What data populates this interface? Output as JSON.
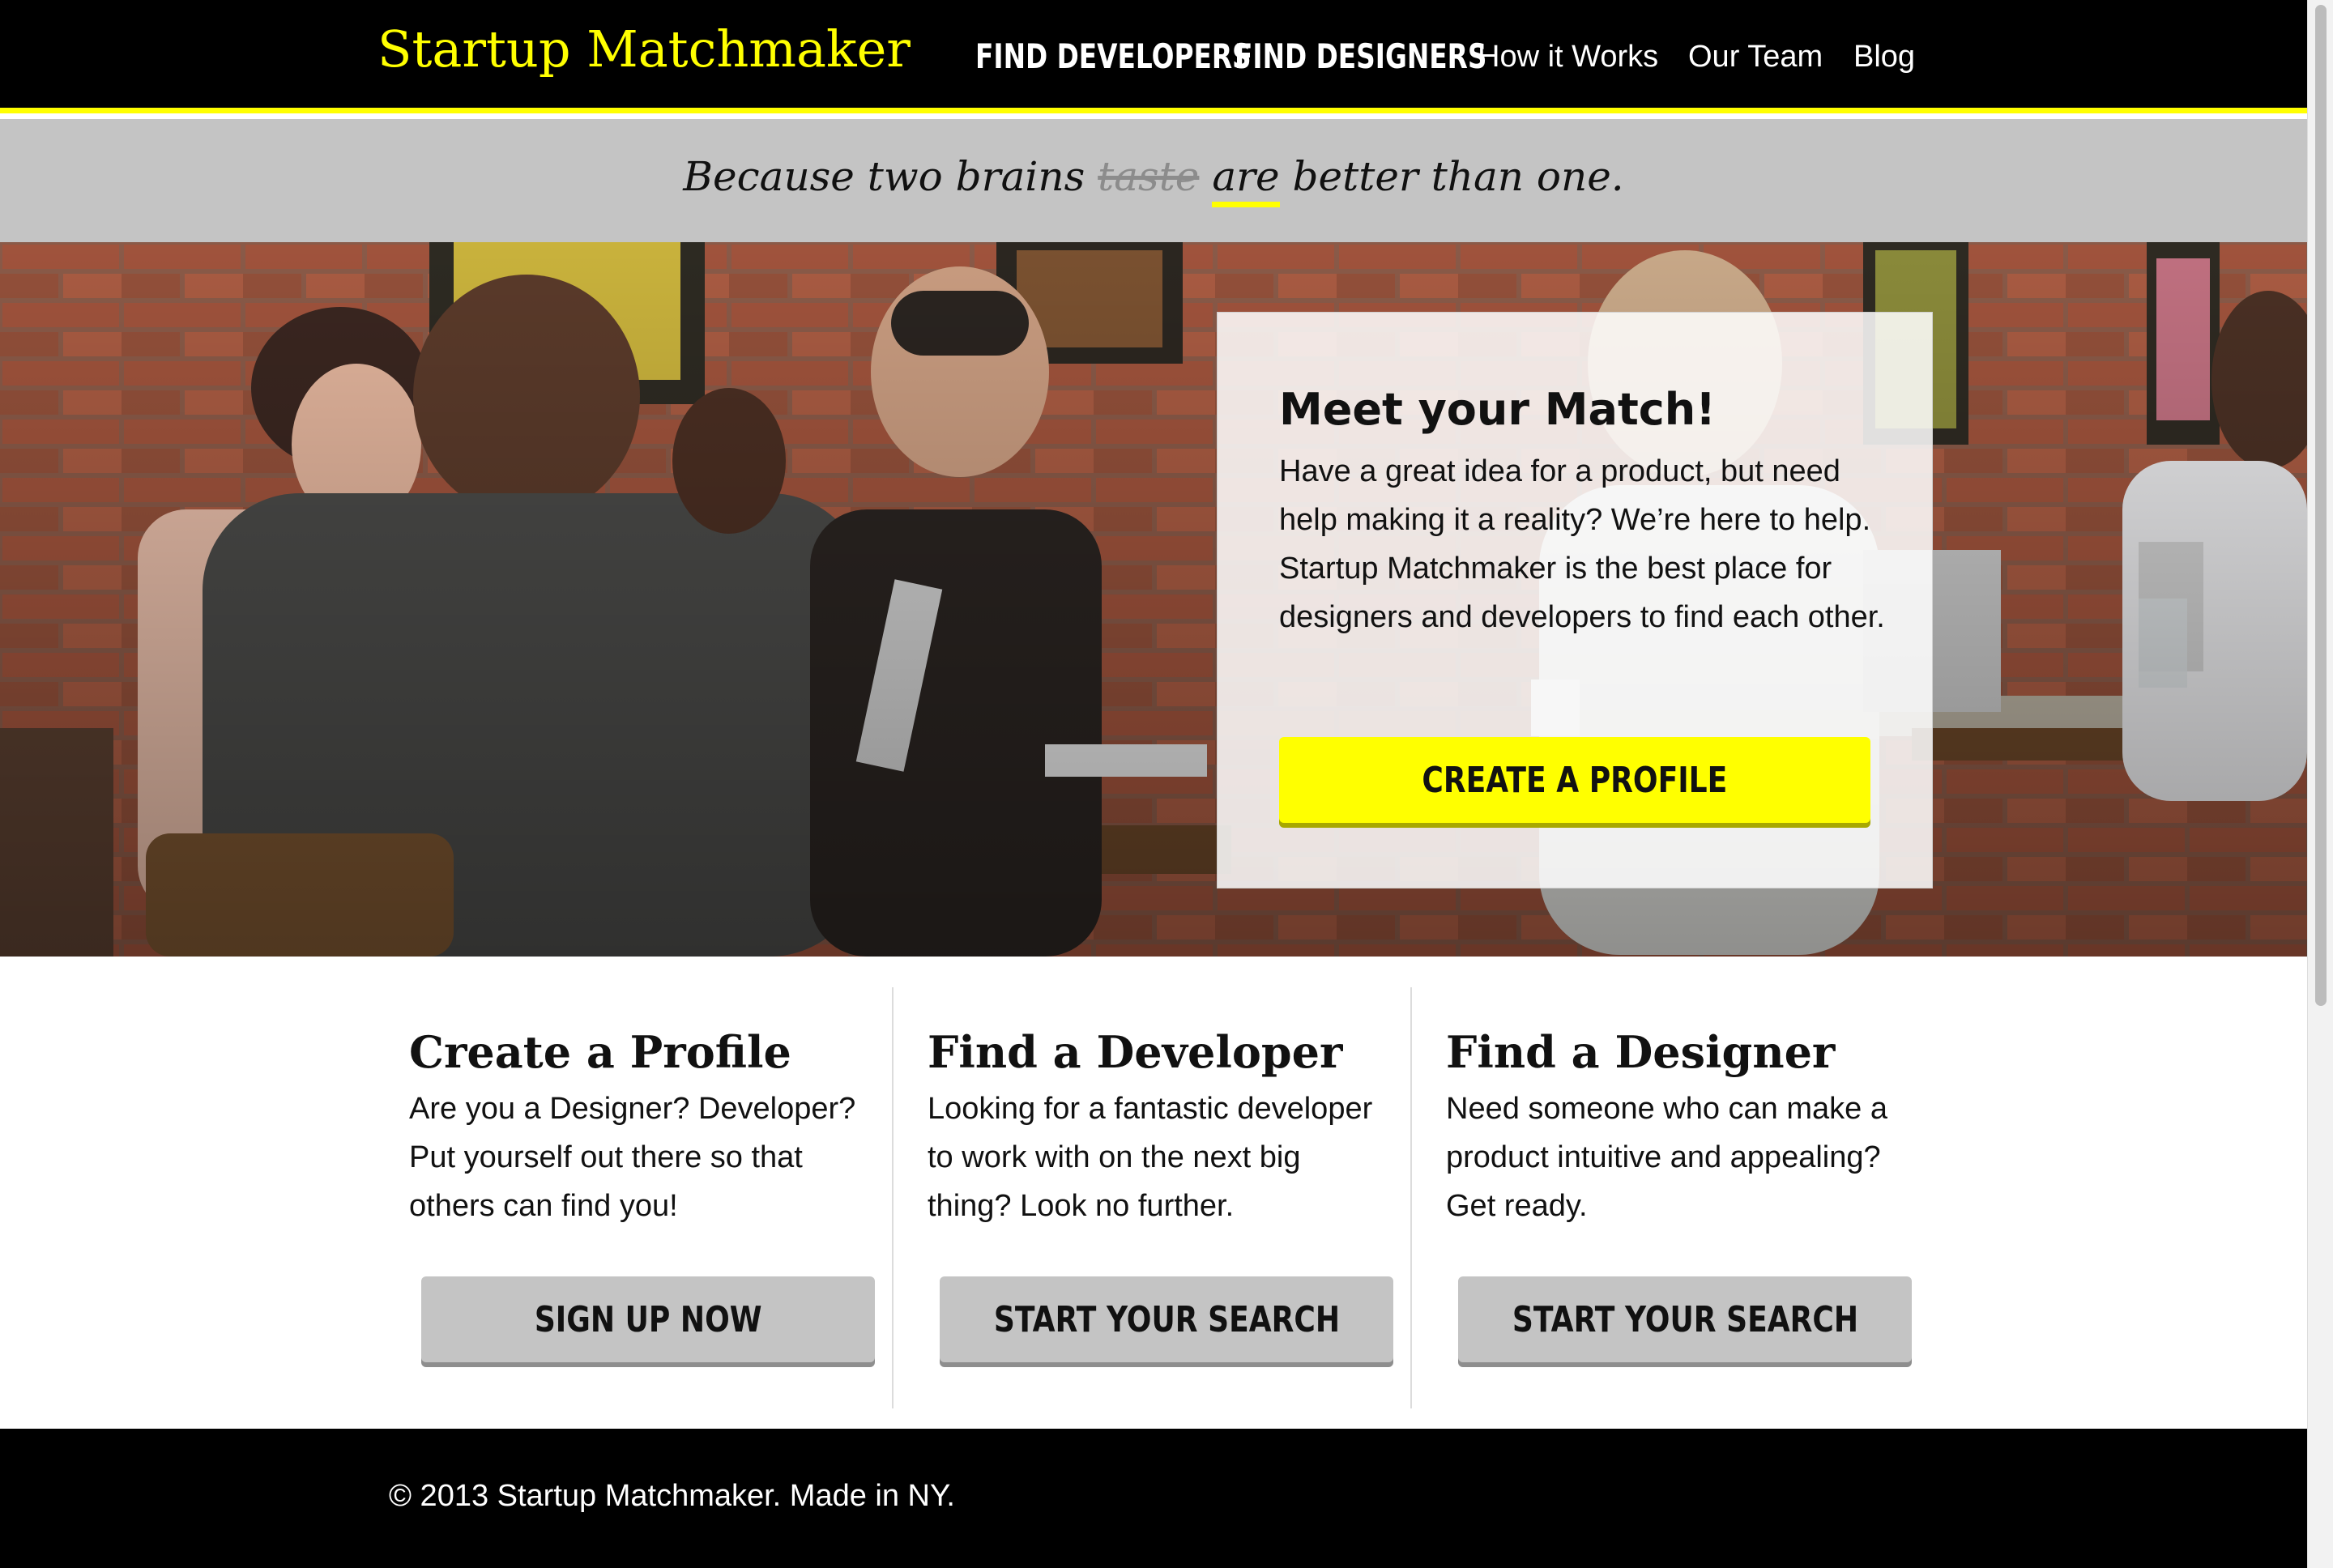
{
  "nav": {
    "brand": "Startup Matchmaker",
    "links": [
      "FIND DEVELOPERS",
      "FIND DESIGNERS",
      "How it Works",
      "Our Team",
      "Blog"
    ]
  },
  "tagline": {
    "before": "Because two brains",
    "struck": "taste",
    "highlight": "are",
    "after": "better than one."
  },
  "hero": {
    "title": "Meet your Match!",
    "text": "Have a great idea for a product, but need help making it a reality? We’re here to help. Startup Matchmaker is the best place for designers and developers to find each other.",
    "cta_label": "CREATE A PROFILE"
  },
  "features": [
    {
      "title": "Create a Profile",
      "text": "Are you a Designer? Developer? Put yourself out there so that others can find you!",
      "button": "SIGN UP NOW"
    },
    {
      "title": "Find a Developer",
      "text": "Looking for a fantastic developer to work with on the next big thing? Look no further.",
      "button": "START YOUR SEARCH"
    },
    {
      "title": "Find a Designer",
      "text": "Need someone who can make a product intuitive and appealing? Get ready.",
      "button": "START YOUR SEARCH"
    }
  ],
  "footer": {
    "text": "© 2013 Startup Matchmaker. Made in NY."
  },
  "colors": {
    "accent": "#ffff00",
    "nav_bg": "#000000",
    "tagline_bg": "#c4c4c4",
    "button_gray": "#c4c4c4"
  }
}
